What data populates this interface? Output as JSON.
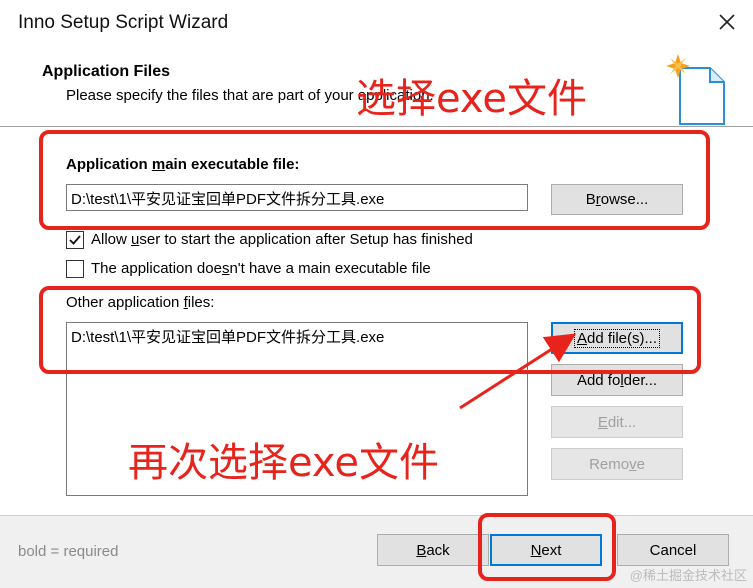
{
  "window": {
    "title": "Inno Setup Script Wizard"
  },
  "header": {
    "title": "Application Files",
    "subtitle": "Please specify the files that are part of your application."
  },
  "main_exe": {
    "label_pre": "Application ",
    "label_u": "m",
    "label_post": "ain executable file:",
    "value": "D:\\test\\1\\平安见证宝回单PDF文件拆分工具.exe",
    "browse_pre": "B",
    "browse_u": "r",
    "browse_post": "owse..."
  },
  "options": {
    "allow_user_pre": "Allow ",
    "allow_user_u": "u",
    "allow_user_post": "ser to start the application after Setup has finished",
    "allow_user_checked": true,
    "no_exe_pre": "The application doe",
    "no_exe_u": "s",
    "no_exe_post": "n't have a main executable file",
    "no_exe_checked": false
  },
  "other_files": {
    "label_pre": "Other application ",
    "label_u": "f",
    "label_post": "iles:",
    "items": [
      "D:\\test\\1\\平安见证宝回单PDF文件拆分工具.exe"
    ],
    "add_file_u": "A",
    "add_file_post": "dd file(s)...",
    "add_folder_pre": "Add fo",
    "add_folder_u": "l",
    "add_folder_post": "der...",
    "edit_u": "E",
    "edit_post": "dit...",
    "remove_pre": "Remo",
    "remove_u": "v",
    "remove_post": "e"
  },
  "footer": {
    "note": "bold = required",
    "back_u": "B",
    "back_post": "ack",
    "next_u": "N",
    "next_post": "ext",
    "cancel": "Cancel"
  },
  "annotations": {
    "first": "选择exe文件",
    "second": "再次选择exe文件",
    "color": "#e8231c"
  },
  "watermark": "@稀土掘金技术社区"
}
